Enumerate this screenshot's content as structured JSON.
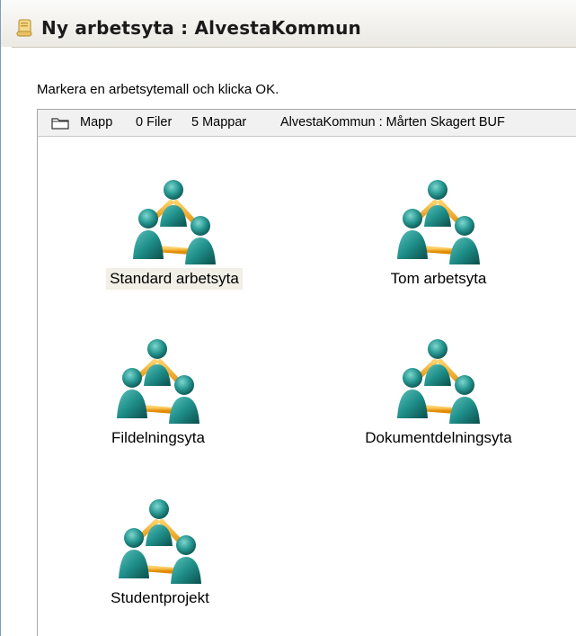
{
  "window": {
    "title": "Ny arbetsyta : AlvestaKommun",
    "icon": "scroll-icon"
  },
  "instruction": "Markera en arbetsytemall och klicka OK.",
  "pathbar": {
    "folder_icon": "folder-icon",
    "type_label": "Mapp",
    "files": "0 Filer",
    "folders": "5 Mappar",
    "location": "AlvestaKommun : Mårten Skagert BUF"
  },
  "templates": [
    {
      "label": "Standard arbetsyta",
      "icon": "workspace-group-icon",
      "selected": true
    },
    {
      "label": "Tom arbetsyta",
      "icon": "workspace-group-icon",
      "selected": false
    },
    {
      "label": "Fildelningsyta",
      "icon": "workspace-group-icon",
      "selected": false
    },
    {
      "label": "Dokumentdelningsyta",
      "icon": "workspace-group-icon",
      "selected": false
    },
    {
      "label": "Studentprojekt",
      "icon": "workspace-group-icon",
      "selected": false
    }
  ],
  "colors": {
    "person_teal": "#1f8f8a",
    "link_orange": "#f0a21c",
    "selection_bg": "#f1efe6"
  }
}
